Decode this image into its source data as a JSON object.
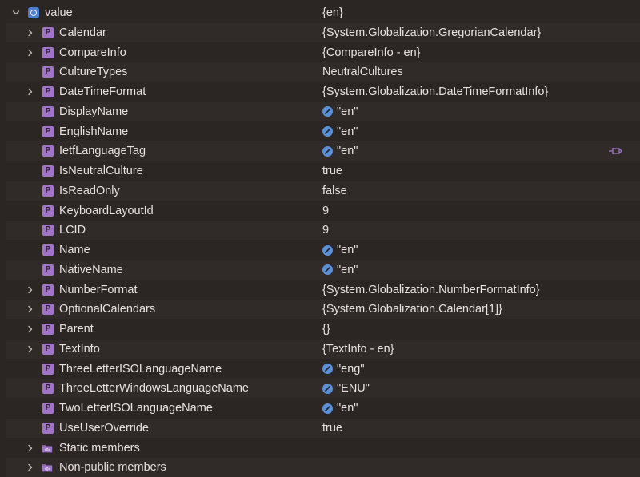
{
  "root": {
    "name": "value",
    "value": "{en}",
    "icon": "object-icon",
    "expanded": true
  },
  "rows": [
    {
      "name": "Calendar",
      "value": "{System.Globalization.GregorianCalendar}",
      "expandable": true,
      "string": false
    },
    {
      "name": "CompareInfo",
      "value": "{CompareInfo - en}",
      "expandable": true,
      "string": false
    },
    {
      "name": "CultureTypes",
      "value": "NeutralCultures",
      "expandable": false,
      "string": false
    },
    {
      "name": "DateTimeFormat",
      "value": "{System.Globalization.DateTimeFormatInfo}",
      "expandable": true,
      "string": false
    },
    {
      "name": "DisplayName",
      "value": "\"en\"",
      "expandable": false,
      "string": true
    },
    {
      "name": "EnglishName",
      "value": "\"en\"",
      "expandable": false,
      "string": true
    },
    {
      "name": "IetfLanguageTag",
      "value": "\"en\"",
      "expandable": false,
      "string": true,
      "pinned": true
    },
    {
      "name": "IsNeutralCulture",
      "value": "true",
      "expandable": false,
      "string": false
    },
    {
      "name": "IsReadOnly",
      "value": "false",
      "expandable": false,
      "string": false
    },
    {
      "name": "KeyboardLayoutId",
      "value": "9",
      "expandable": false,
      "string": false
    },
    {
      "name": "LCID",
      "value": "9",
      "expandable": false,
      "string": false
    },
    {
      "name": "Name",
      "value": "\"en\"",
      "expandable": false,
      "string": true
    },
    {
      "name": "NativeName",
      "value": "\"en\"",
      "expandable": false,
      "string": true
    },
    {
      "name": "NumberFormat",
      "value": "{System.Globalization.NumberFormatInfo}",
      "expandable": true,
      "string": false
    },
    {
      "name": "OptionalCalendars",
      "value": "{System.Globalization.Calendar[1]}",
      "expandable": true,
      "string": false
    },
    {
      "name": "Parent",
      "value": "{}",
      "expandable": true,
      "string": false
    },
    {
      "name": "TextInfo",
      "value": "{TextInfo - en}",
      "expandable": true,
      "string": false
    },
    {
      "name": "ThreeLetterISOLanguageName",
      "value": "\"eng\"",
      "expandable": false,
      "string": true
    },
    {
      "name": "ThreeLetterWindowsLanguageName",
      "value": "\"ENU\"",
      "expandable": false,
      "string": true
    },
    {
      "name": "TwoLetterISOLanguageName",
      "value": "\"en\"",
      "expandable": false,
      "string": true
    },
    {
      "name": "UseUserOverride",
      "value": "true",
      "expandable": false,
      "string": false
    }
  ],
  "groups": [
    {
      "name": "Static members",
      "expandable": true
    },
    {
      "name": "Non-public members",
      "expandable": true
    }
  ],
  "property_badge": "P",
  "colors": {
    "background": "#2b2624",
    "row_band": "#302b28",
    "property_icon": "#a274c9",
    "object_icon": "#4b7fd0",
    "string_icon": "#5b8fd8",
    "pin_icon": "#a274c9",
    "text": "#e6e2de"
  }
}
